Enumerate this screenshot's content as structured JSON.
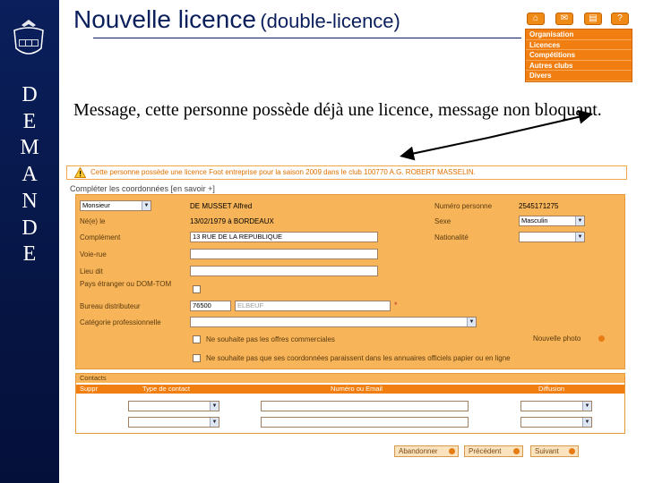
{
  "colors": {
    "navy": "#0a1f5c",
    "orange": "#f07e10",
    "form_bg": "#f7b458",
    "warning": "#e07000"
  },
  "title": {
    "main": "Nouvelle licence",
    "sub": "(double-licence)"
  },
  "vertical_word": [
    "D",
    "E",
    "M",
    "A",
    "N",
    "D",
    "E"
  ],
  "top_icons": [
    "home-icon",
    "mail-icon",
    "print-icon",
    "help-icon"
  ],
  "menu": [
    "Organisation",
    "Licences",
    "Compétitions",
    "Autres clubs",
    "Divers"
  ],
  "description": "Message, cette personne possède déjà une licence, message non bloquant.",
  "warning": "Cette personne possède une licence Foot entreprise pour la saison 2009 dans le club 100770 A.G. ROBERT MASSELIN.",
  "section_title": "Compléter les coordonnées [en savoir +]",
  "form": {
    "civility": "Monsieur",
    "full_name": "DE MUSSET Alfred",
    "born_label": "Né(e) le",
    "born_value": "13/02/1979  à  BORDEAUX",
    "complement_label": "Complément",
    "complement_value": "13 RUE DE LA REPUBLIQUE",
    "voie_label": "Voie-rue",
    "lieu_label": "Lieu dit",
    "pays_label": "Pays étranger ou DOM-TOM",
    "bureau_label": "Bureau distributeur",
    "postal_code": "76500",
    "city": "ELBEUF",
    "categorie_label": "Catégorie professionnelle",
    "check1": "Ne souhaite pas les offres commerciales",
    "check2": "Ne souhaite pas que ses coordonnées paraissent dans les annuaires officiels papier ou en ligne",
    "numero_label": "Numéro personne",
    "numero_value": "2545171275",
    "sexe_label": "Sexe",
    "sexe_value": "Masculin",
    "nationalite_label": "Nationalité",
    "photo_label": "Nouvelle photo"
  },
  "contacts": {
    "title": "Contacts",
    "columns": [
      "Suppr",
      "Type de contact",
      "Numéro ou Email",
      "Diffusion"
    ]
  },
  "buttons": {
    "abandon": "Abandonner",
    "previous": "Précédent",
    "next": "Suivant"
  }
}
